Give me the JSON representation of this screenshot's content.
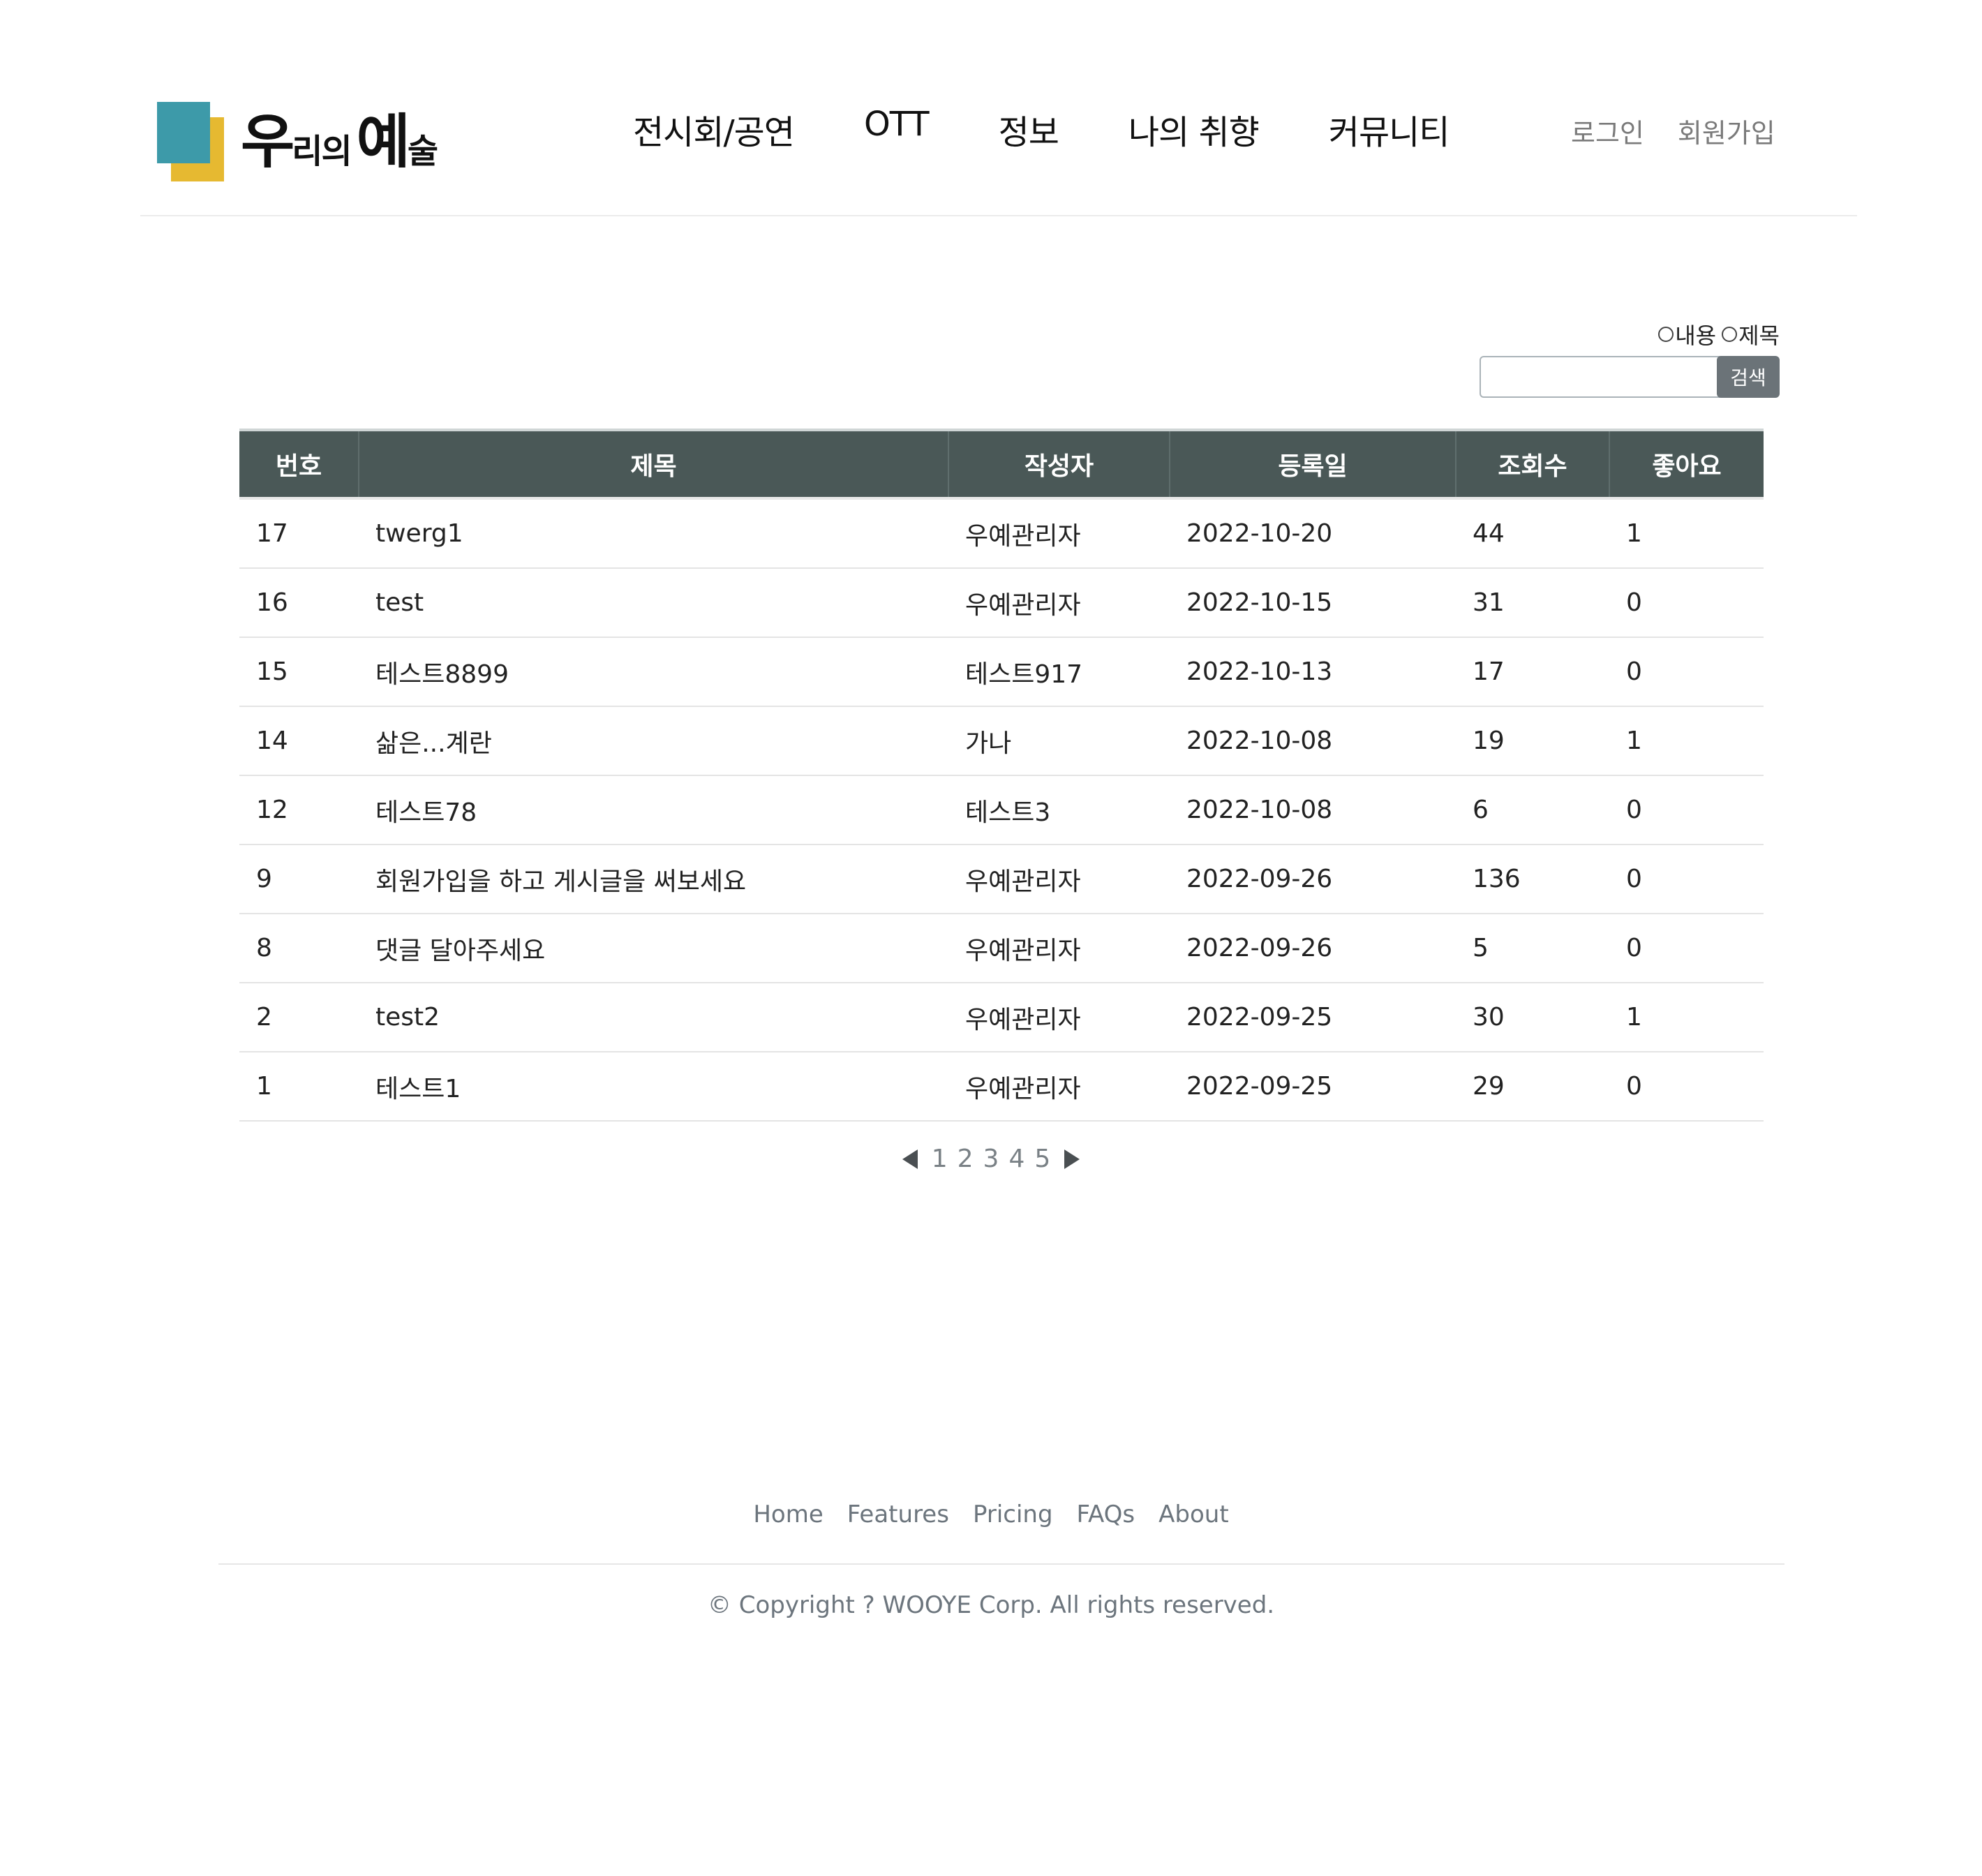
{
  "header": {
    "logo": {
      "text_1": "우",
      "text_2": "리의",
      "text_3": "예",
      "text_4": "술",
      "colors": {
        "front": "#3d9aa9",
        "back": "#e6b931"
      }
    },
    "nav": [
      "전시회/공연",
      "OTT",
      "정보",
      "나의 취향",
      "커뮤니티"
    ],
    "auth": {
      "login": "로그인",
      "signup": "회원가입"
    }
  },
  "search": {
    "options": [
      "내용",
      "제목"
    ],
    "input_value": "",
    "button_label": "검색"
  },
  "board": {
    "columns": [
      "번호",
      "제목",
      "작성자",
      "등록일",
      "조회수",
      "좋아요"
    ],
    "header_color": "#4a5857",
    "rows": [
      [
        "17",
        "twerg1",
        "우예관리자",
        "2022-10-20",
        "44",
        "1"
      ],
      [
        "16",
        "test",
        "우예관리자",
        "2022-10-15",
        "31",
        "0"
      ],
      [
        "15",
        "테스트8899",
        "테스트917",
        "2022-10-13",
        "17",
        "0"
      ],
      [
        "14",
        "삶은...계란",
        "가나",
        "2022-10-08",
        "19",
        "1"
      ],
      [
        "12",
        "테스트78",
        "테스트3",
        "2022-10-08",
        "6",
        "0"
      ],
      [
        "9",
        "회원가입을 하고 게시글을 써보세요",
        "우예관리자",
        "2022-09-26",
        "136",
        "0"
      ],
      [
        "8",
        "댓글 달아주세요",
        "우예관리자",
        "2022-09-26",
        "5",
        "0"
      ],
      [
        "2",
        "test2",
        "우예관리자",
        "2022-09-25",
        "30",
        "1"
      ],
      [
        "1",
        "테스트1",
        "우예관리자",
        "2022-09-25",
        "29",
        "0"
      ]
    ]
  },
  "pagination": {
    "pages": [
      "1",
      "2",
      "3",
      "4",
      "5"
    ],
    "prev_icon": "caret-left-icon",
    "next_icon": "caret-right-icon"
  },
  "footer": {
    "links": [
      "Home",
      "Features",
      "Pricing",
      "FAQs",
      "About"
    ],
    "copyright": "© Copyright ? WOOYE Corp. All rights reserved."
  }
}
